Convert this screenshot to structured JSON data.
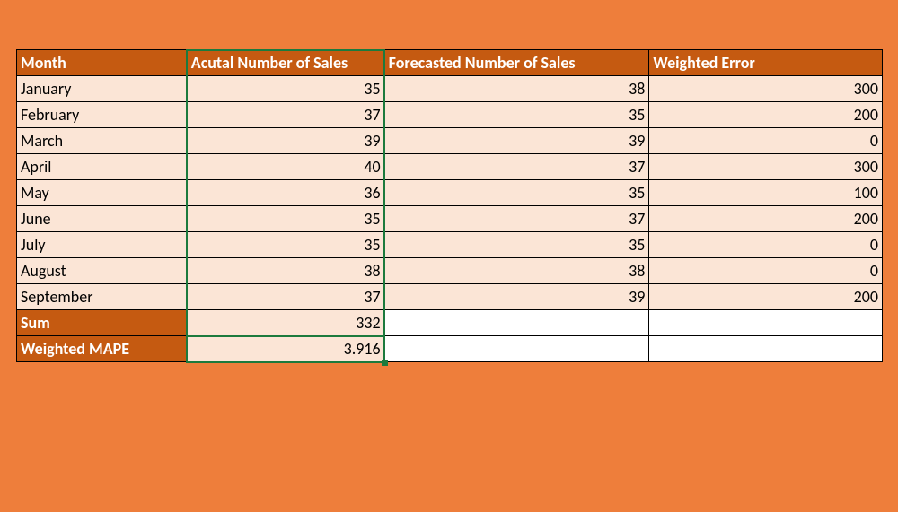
{
  "chart_data": {
    "type": "table",
    "headers": [
      "Month",
      "Acutal Number of Sales",
      "Forecasted Number of Sales",
      "Weighted Error"
    ],
    "rows": [
      [
        "January",
        35,
        38,
        300
      ],
      [
        "February",
        37,
        35,
        200
      ],
      [
        "March",
        39,
        39,
        0
      ],
      [
        "April",
        40,
        37,
        300
      ],
      [
        "May",
        36,
        35,
        100
      ],
      [
        "June",
        35,
        37,
        200
      ],
      [
        "July",
        35,
        35,
        0
      ],
      [
        "August",
        38,
        38,
        0
      ],
      [
        "September",
        37,
        39,
        200
      ]
    ],
    "footer": [
      {
        "label": "Sum",
        "value": 332
      },
      {
        "label": "Weighted MAPE",
        "value": 3.916
      }
    ]
  },
  "headers": {
    "month": "Month",
    "actual": "Acutal Number of Sales",
    "forecast": "Forecasted Number of Sales",
    "werror": "Weighted Error"
  },
  "rows": [
    {
      "month": "January",
      "actual": "35",
      "forecast": "38",
      "werror": "300"
    },
    {
      "month": "February",
      "actual": "37",
      "forecast": "35",
      "werror": "200"
    },
    {
      "month": "March",
      "actual": "39",
      "forecast": "39",
      "werror": "0"
    },
    {
      "month": "April",
      "actual": "40",
      "forecast": "37",
      "werror": "300"
    },
    {
      "month": "May",
      "actual": "36",
      "forecast": "35",
      "werror": "100"
    },
    {
      "month": "June",
      "actual": "35",
      "forecast": "37",
      "werror": "200"
    },
    {
      "month": "July",
      "actual": "35",
      "forecast": "35",
      "werror": "0"
    },
    {
      "month": "August",
      "actual": "38",
      "forecast": "38",
      "werror": "0"
    },
    {
      "month": "September",
      "actual": "37",
      "forecast": "39",
      "werror": "200"
    }
  ],
  "sum": {
    "label": "Sum",
    "value": "332"
  },
  "wmape": {
    "label": "Weighted MAPE",
    "value": "3.916"
  }
}
